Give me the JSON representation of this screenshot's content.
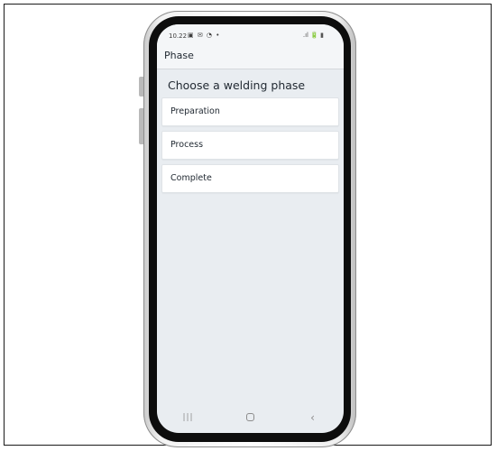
{
  "status_bar": {
    "time": "10.22",
    "left_icons": "▣ ✉ ◔  •",
    "right_icons": ".ıl 🔋 ▮"
  },
  "app_bar": {
    "title": "Phase"
  },
  "main": {
    "heading": "Choose a welding phase",
    "phases": [
      {
        "label": "Preparation"
      },
      {
        "label": "Process"
      },
      {
        "label": "Complete"
      }
    ]
  },
  "nav_bar": {
    "recent_icon": "|||",
    "home_icon": "home",
    "back_icon": "‹"
  }
}
